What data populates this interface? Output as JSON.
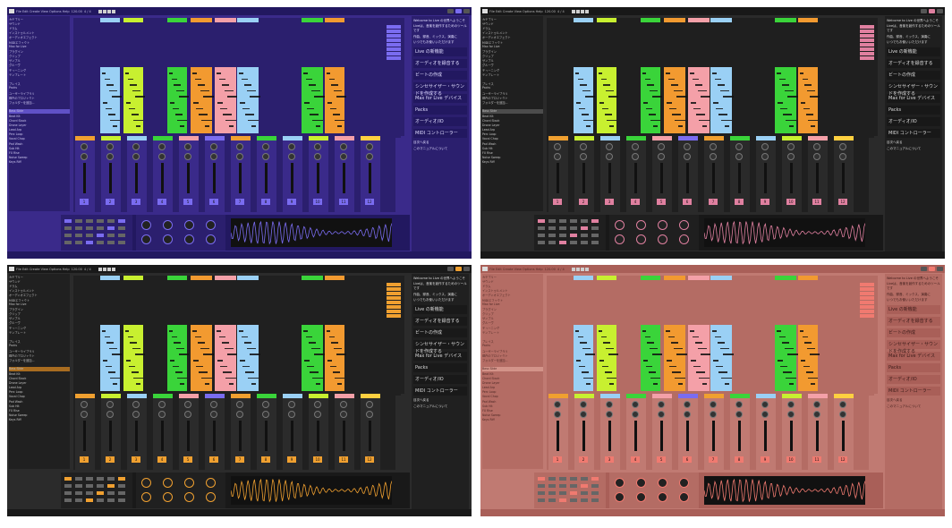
{
  "image": {
    "width": 1064,
    "height": 590
  },
  "themes": [
    {
      "name": "purple",
      "bg": "#3a2a8a",
      "panel": "#2b1f6e",
      "topbar": "#221860",
      "accent": "#7a6cf0",
      "text": "#e0dcff",
      "selected": "#6a5ad6"
    },
    {
      "name": "dark",
      "bg": "#2a2a2a",
      "panel": "#1f1f1f",
      "topbar": "#181818",
      "accent": "#e080a0",
      "text": "#dddddd",
      "selected": "#555555"
    },
    {
      "name": "dark-orange",
      "bg": "#2b2b2b",
      "panel": "#202020",
      "topbar": "#191919",
      "accent": "#f0a030",
      "text": "#dddddd",
      "selected": "#c07a20"
    },
    {
      "name": "salmon",
      "bg": "#c07a72",
      "panel": "#b46c64",
      "topbar": "#a95f58",
      "accent": "#f07a70",
      "text": "#3a1a18",
      "selected": "#d99a90"
    }
  ],
  "clip_colors": [
    "#9ad0f5",
    "#c8f030",
    "#3ad43a",
    "#f29a30",
    "#f4a0a8",
    "#9ad0f5",
    "#3ad43a",
    "#f29a30"
  ],
  "strip_colors": [
    "#f0a030",
    "#c8f030",
    "#9ad0f5",
    "#3ad43a",
    "#f4a0a8",
    "#7a6cf0",
    "#f0a030",
    "#3ad43a",
    "#9ad0f5",
    "#c8f030",
    "#f4a0a8",
    "#ffd040"
  ],
  "topbar": {
    "menu": "File   Edit   Create   View   Options   Help",
    "tempo": "120.00",
    "sig": "4 / 4"
  },
  "mixer": {
    "track_numbers": [
      "1",
      "2",
      "3",
      "4",
      "5",
      "6",
      "7",
      "8",
      "9",
      "10",
      "11",
      "12"
    ]
  },
  "help": {
    "intro": "Welcome to Live の世界へようこそ",
    "lines": [
      "Liveは、音楽を創作するためのツールです",
      "作曲、録音、ミックス、演奏に",
      "いつでもお使いいただけます"
    ],
    "items": [
      "Live の新機能",
      "オーディオを録音する",
      "ビートの作成",
      "シンセサイザー・サウンドを作成する",
      "Max for Live デバイス",
      "Packs",
      "オーディオ/IO",
      "MIDI コントローラー"
    ],
    "footer": "目次へ戻る",
    "footer2": "このマニュアルについて"
  },
  "browser": {
    "rows": [
      "カテゴリー",
      "サウンド",
      "ドラム",
      "インストゥルメント",
      "オーディオエフェクト",
      "MIDIエフェクト",
      "Max for Live",
      "プラグイン",
      "クリップ",
      "サンプル",
      "グルーヴ",
      "チューニング",
      "テンプレート",
      "",
      "プレイス",
      "Packs",
      "ユーザーライブラリ",
      "現在のプロジェクト",
      "フォルダーを追加...",
      "",
      "Bass Slide",
      "Beat Kit",
      "Chord Stack",
      "Drone Layer",
      "Lead Arp",
      "Perc Loop",
      "Vocal Chop",
      "Pad Wash",
      "Sub Hit",
      "FX Rise",
      "Noise Sweep",
      "Keys Riff"
    ]
  }
}
